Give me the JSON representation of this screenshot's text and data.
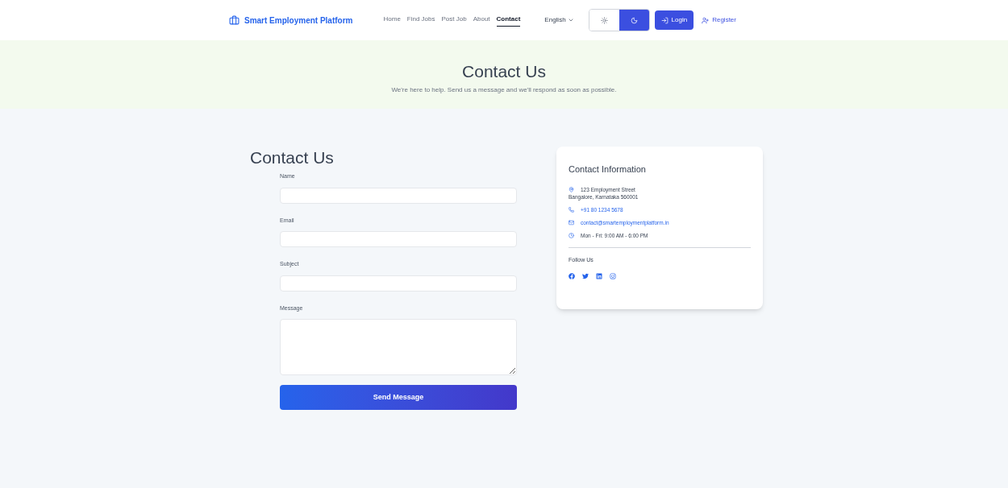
{
  "brand": "Smart Employment Platform",
  "nav": [
    {
      "label": "Home",
      "selected": false
    },
    {
      "label": "Find Jobs",
      "selected": false
    },
    {
      "label": "Post Job",
      "selected": false
    },
    {
      "label": "About",
      "selected": false
    },
    {
      "label": "Contact",
      "selected": true
    }
  ],
  "language": "English",
  "theme_toggle": {
    "dark": true
  },
  "login": "Login",
  "register": "Register",
  "hero": {
    "title": "Contact Us",
    "subtitle": "We're here to help. Send us a message and we'll respond as soon as possible."
  },
  "form": {
    "title": "Contact Us",
    "fields": [
      {
        "label": "Name",
        "kind": "input"
      },
      {
        "label": "Email",
        "kind": "input"
      },
      {
        "label": "Subject",
        "kind": "input"
      },
      {
        "label": "Message",
        "kind": "textarea"
      }
    ],
    "submit": "Send Message"
  },
  "info": {
    "title": "Contact Information",
    "items": [
      {
        "kind": "address",
        "lines": [
          "123 Employment Street",
          "Bangalore, Karnataka 560001"
        ]
      },
      {
        "kind": "phone",
        "lines": [
          "+91 80 1234 5678"
        ]
      },
      {
        "kind": "email",
        "lines": [
          "contact@smartemploymentplatform.in"
        ]
      },
      {
        "kind": "hours",
        "lines": [
          "Mon - Fri: 9:00 AM - 6:00 PM"
        ]
      }
    ],
    "follow": "Follow Us",
    "social": [
      {
        "kind": "facebook"
      },
      {
        "kind": "twitter"
      },
      {
        "kind": "linkedin"
      },
      {
        "kind": "instagram"
      }
    ]
  }
}
